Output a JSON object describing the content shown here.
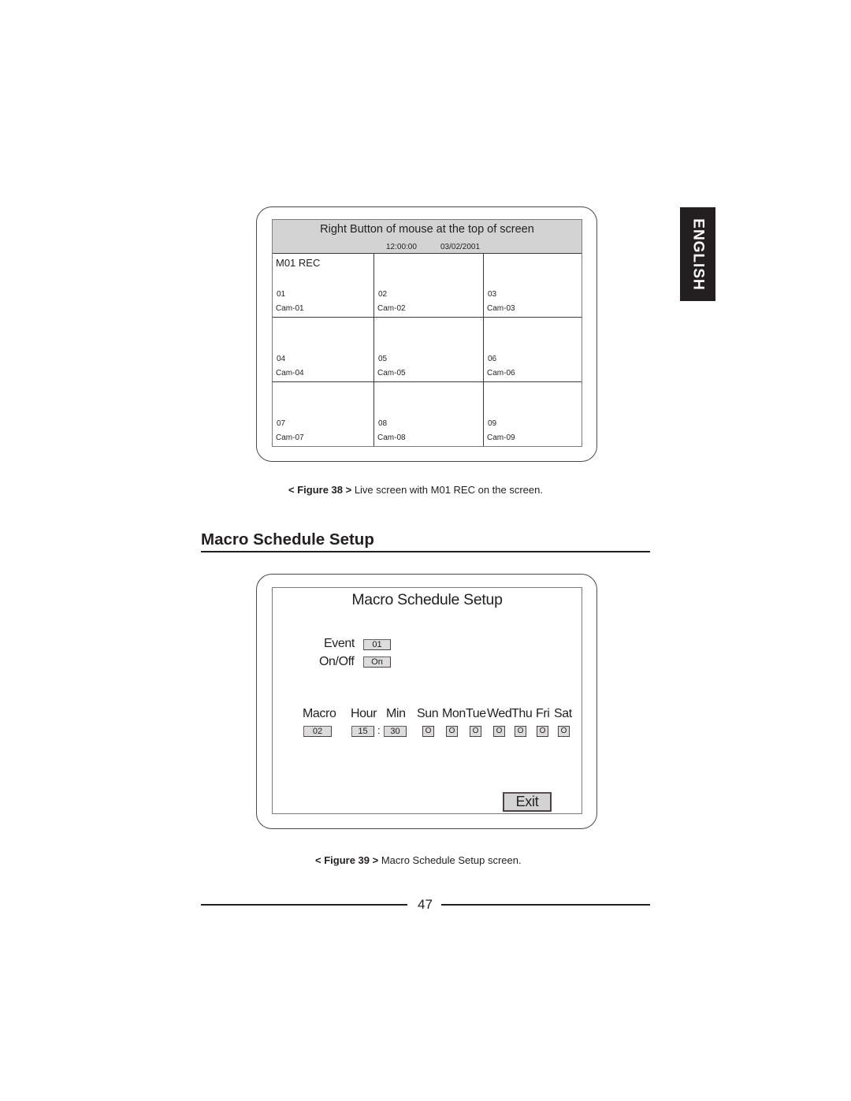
{
  "side_tab": {
    "label": "ENGLISH",
    "background": "#231f20",
    "text_color": "#ffffff"
  },
  "figure38": {
    "header_title": "Right Button of mouse at the top of screen",
    "time": "12:00:00",
    "date": "03/02/2001",
    "header_color": "#d3d3d3",
    "status_label": "M01 REC",
    "cameras": [
      {
        "number": "01",
        "name": "Cam-01"
      },
      {
        "number": "02",
        "name": "Cam-02"
      },
      {
        "number": "03",
        "name": "Cam-03"
      },
      {
        "number": "04",
        "name": "Cam-04"
      },
      {
        "number": "05",
        "name": "Cam-05"
      },
      {
        "number": "06",
        "name": "Cam-06"
      },
      {
        "number": "07",
        "name": "Cam-07"
      },
      {
        "number": "08",
        "name": "Cam-08"
      },
      {
        "number": "09",
        "name": "Cam-09"
      }
    ],
    "caption_prefix": "< Figure 38 >",
    "caption_text": " Live screen with M01 REC on the screen."
  },
  "section": {
    "title": "Macro Schedule Setup"
  },
  "figure39": {
    "screen_title": "Macro Schedule Setup",
    "event_label": "Event",
    "event_value": "01",
    "onoff_label": "On/Off",
    "onoff_value": "On",
    "columns": {
      "macro": "Macro",
      "hour": "Hour",
      "min": "Min"
    },
    "macro_value": "02",
    "hour_value": "15",
    "time_separator": ":",
    "min_value": "30",
    "days": [
      {
        "label": "Sun",
        "value": "O"
      },
      {
        "label": "Mon",
        "value": "O"
      },
      {
        "label": "Tue",
        "value": "O"
      },
      {
        "label": "Wed",
        "value": "O"
      },
      {
        "label": "Thu",
        "value": "O"
      },
      {
        "label": "Fri",
        "value": "O"
      },
      {
        "label": "Sat",
        "value": "O"
      }
    ],
    "exit_label": "Exit",
    "caption_prefix": "< Figure 39 >",
    "caption_text": " Macro Schedule Setup screen."
  },
  "footer": {
    "page_number": "47"
  }
}
